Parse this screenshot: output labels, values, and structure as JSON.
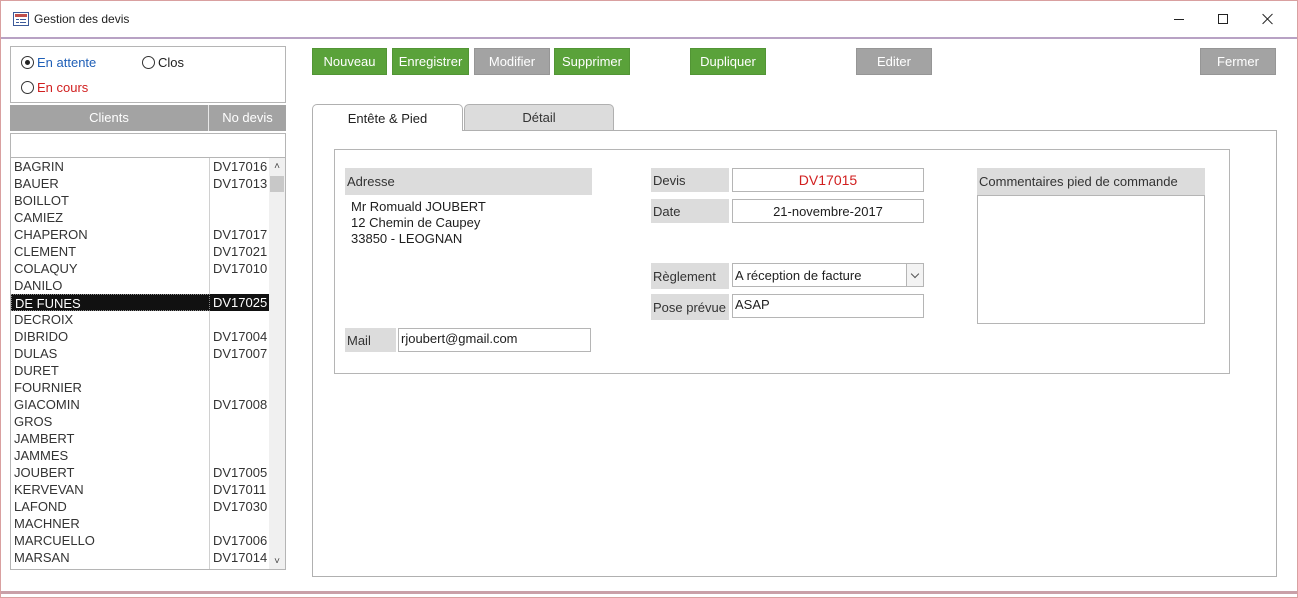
{
  "window": {
    "title": "Gestion des devis",
    "accent_color": "#5aa23a",
    "highlight_color": "#d11f1f"
  },
  "filters": {
    "en_attente": {
      "label": "En attente",
      "checked": true
    },
    "clos": {
      "label": "Clos",
      "checked": false
    },
    "en_cours": {
      "label": "En cours",
      "checked": false
    }
  },
  "list": {
    "headers": {
      "clients": "Clients",
      "no_devis": "No devis"
    },
    "search_value": "",
    "selected_index": 7,
    "rows": [
      {
        "client": "BAGRIN",
        "devis": "DV17016"
      },
      {
        "client": "BAUER",
        "devis": "DV17013"
      },
      {
        "client": "BOILLOT",
        "devis": ""
      },
      {
        "client": "CAMIEZ",
        "devis": ""
      },
      {
        "client": "CHAPERON",
        "devis": "DV17017"
      },
      {
        "client": "CLEMENT",
        "devis": "DV17021"
      },
      {
        "client": "COLAQUY",
        "devis": "DV17010"
      },
      {
        "client": "DANILO",
        "devis": ""
      },
      {
        "client": "DE FUNES",
        "devis": "DV17025"
      },
      {
        "client": "DECROIX",
        "devis": ""
      },
      {
        "client": "DIBRIDO",
        "devis": "DV17004"
      },
      {
        "client": "DULAS",
        "devis": "DV17007"
      },
      {
        "client": "DURET",
        "devis": ""
      },
      {
        "client": "FOURNIER",
        "devis": ""
      },
      {
        "client": "GIACOMIN",
        "devis": "DV17008"
      },
      {
        "client": "GROS",
        "devis": ""
      },
      {
        "client": "JAMBERT",
        "devis": ""
      },
      {
        "client": "JAMMES",
        "devis": ""
      },
      {
        "client": "JOUBERT",
        "devis": "DV17005"
      },
      {
        "client": "KERVEVAN",
        "devis": "DV17011"
      },
      {
        "client": "LAFOND",
        "devis": "DV17030"
      },
      {
        "client": "MACHNER",
        "devis": ""
      },
      {
        "client": "MARCUELLO",
        "devis": "DV17006"
      },
      {
        "client": "MARSAN",
        "devis": "DV17014"
      }
    ]
  },
  "toolbar": {
    "nouveau": "Nouveau",
    "enregistrer": "Enregistrer",
    "modifier": "Modifier",
    "supprimer": "Supprimer",
    "dupliquer": "Dupliquer",
    "editer": "Editer",
    "fermer": "Fermer"
  },
  "tabs": {
    "entete": "Entête & Pied",
    "detail": "Détail"
  },
  "form": {
    "adresse_label": "Adresse",
    "address_lines": [
      "Mr Romuald JOUBERT",
      "12 Chemin de Caupey",
      "33850 - LEOGNAN"
    ],
    "mail_label": "Mail",
    "mail_value": "rjoubert@gmail.com",
    "devis_label": "Devis",
    "devis_value": "DV17015",
    "date_label": "Date",
    "date_value": "21-novembre-2017",
    "reglement_label": "Règlement",
    "reglement_value": "A réception de facture",
    "pose_label": "Pose prévue",
    "pose_value": "ASAP",
    "comments_label": "Commentaires pied de commande",
    "comments_value": ""
  }
}
